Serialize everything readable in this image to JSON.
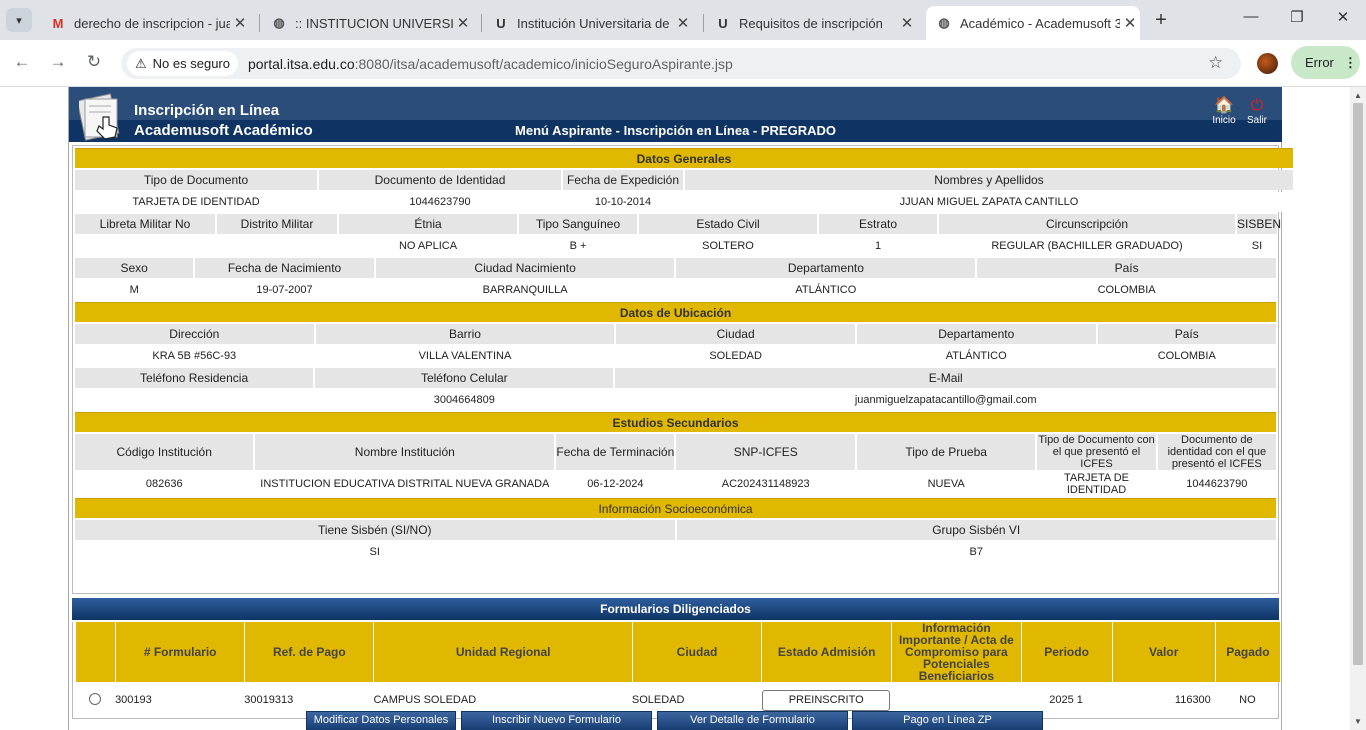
{
  "browser": {
    "tabs": [
      {
        "label": "derecho de inscripcion - juan",
        "icon": "gmail-icon"
      },
      {
        "label": ":: INSTITUCION UNIVERSITARIA",
        "icon": "globe-icon"
      },
      {
        "label": "Institución Universitaria de B",
        "icon": "itsa-icon"
      },
      {
        "label": "Requisitos de inscripción",
        "icon": "itsa-icon"
      },
      {
        "label": "Académico - Academusoft 3",
        "icon": "globe-icon",
        "active": true
      }
    ],
    "not_secure_label": "No es seguro",
    "url_host": "portal.itsa.edu.co",
    "url_path": ":8080/itsa/academusoft/academico/inicioSeguroAspirante.jsp",
    "error_label": "Error"
  },
  "app": {
    "title_line1": "Inscripción en Línea",
    "title_line2": "Academusoft Académico",
    "menu_title": "Menú Aspirante - Inscripción en Línea - PREGRADO",
    "home_label": "Inicio",
    "exit_label": "Salir"
  },
  "general": {
    "section": "Datos Generales",
    "row1_headers": [
      "Tipo de Documento",
      "Documento de Identidad",
      "Fecha de Expedición",
      "Nombres y Apellidos"
    ],
    "row1_values": [
      "TARJETA DE IDENTIDAD",
      "1044623790",
      "10-10-2014",
      "JJUAN MIGUEL ZAPATA CANTILLO"
    ],
    "row2_headers": [
      "Libreta Militar No",
      "Distrito Militar",
      "Étnia",
      "Tipo Sanguíneo",
      "Estado Civil",
      "Estrato",
      "Circunscripción",
      "SISBEN"
    ],
    "row2_values": [
      "",
      "",
      "NO APLICA",
      "B +",
      "SOLTERO",
      "1",
      "REGULAR (BACHILLER GRADUADO)",
      "SI"
    ],
    "row3_headers": [
      "Sexo",
      "Fecha de Nacimiento",
      "Ciudad Nacimiento",
      "Departamento",
      "País"
    ],
    "row3_values": [
      "M",
      "19-07-2007",
      "BARRANQUILLA",
      "ATLÁNTICO",
      "COLOMBIA"
    ]
  },
  "location": {
    "section": "Datos de Ubicación",
    "row1_headers": [
      "Dirección",
      "Barrio",
      "Ciudad",
      "Departamento",
      "País"
    ],
    "row1_values": [
      "KRA 5B #56C-93",
      "VILLA VALENTINA",
      "SOLEDAD",
      "ATLÁNTICO",
      "COLOMBIA"
    ],
    "row2_headers": [
      "Teléfono Residencia",
      "Teléfono Celular",
      "E-Mail"
    ],
    "row2_values": [
      "",
      "3004664809",
      "juanmiguelzapatacantillo@gmail.com"
    ]
  },
  "studies": {
    "section": "Estudios Secundarios",
    "headers": [
      "Código Institución",
      "Nombre Institución",
      "Fecha de Terminación",
      "SNP-ICFES",
      "Tipo de Prueba",
      "Tipo de Documento con el que presentó el ICFES",
      "Documento de identidad con el que presentó el ICFES"
    ],
    "values": [
      "082636",
      "INSTITUCION EDUCATIVA DISTRITAL NUEVA GRANADA",
      "06-12-2024",
      "AC202431148923",
      "NUEVA",
      "TARJETA DE IDENTIDAD",
      "1044623790"
    ]
  },
  "socio": {
    "section": "Información Socioeconómica",
    "headers": [
      "Tiene Sisbén (SI/NO)",
      "Grupo Sisbén VI"
    ],
    "values": [
      "SI",
      "B7"
    ]
  },
  "forms": {
    "title": "Formularios Diligenciados",
    "headers": [
      "",
      "# Formulario",
      "Ref. de Pago",
      "Unidad Regional",
      "Ciudad",
      "Estado Admisión",
      "Información Importante / Acta de Compromiso para Potenciales Beneficiarios",
      "Periodo",
      "Valor",
      "Pagado"
    ],
    "row": {
      "formulario": "300193",
      "ref_pago": "30019313",
      "unidad": "CAMPUS SOLEDAD",
      "ciudad": "SOLEDAD",
      "estado": "PREINSCRITO",
      "info": "",
      "periodo": "2025 1",
      "valor": "116300",
      "pagado": "NO"
    }
  },
  "actions": [
    "Modificar Datos Personales",
    "Inscribir Nuevo Formulario",
    "Ver Detalle de Formulario",
    "Pago en Línea ZP"
  ],
  "colors": {
    "section_yellow": "#e0b800",
    "header_blue": "#0f3464",
    "header_gray": "#e5e5e5"
  }
}
